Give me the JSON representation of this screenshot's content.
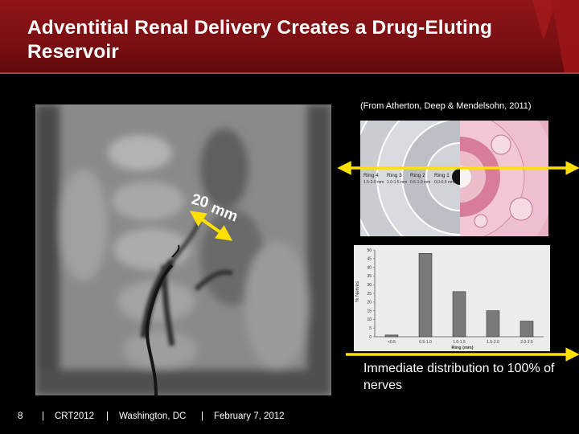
{
  "slide": {
    "title": "Adventitial Renal Delivery Creates a Drug-Eluting Reservoir",
    "citation": "(From Atherton, Deep & Mendelsohn, 2011)",
    "measurement": {
      "number": "20",
      "unit": "mm"
    },
    "caption": "Immediate distribution to 100% of nerves"
  },
  "diagram": {
    "rings": [
      {
        "name": "Ring 4",
        "range": "1.5-2.0 mm"
      },
      {
        "name": "Ring 3",
        "range": "1.0-1.5 mm"
      },
      {
        "name": "Ring 2",
        "range": "0.5-1.0 mm"
      },
      {
        "name": "Ring 1",
        "range": "0.0-0.5 mm"
      }
    ]
  },
  "chart_data": {
    "type": "bar",
    "categories": [
      "<0.5",
      "0.5-1.0",
      "1.0-1.5",
      "1.5-2.0",
      "2.0-2.5"
    ],
    "values": [
      1,
      48,
      26,
      15,
      9
    ],
    "ylim": [
      0,
      50
    ],
    "yticks": [
      "0",
      "5",
      "10",
      "15",
      "20",
      "25",
      "30",
      "35",
      "40",
      "45",
      "50"
    ],
    "xlabel": "Ring (mm)",
    "ylabel": "% Nerves",
    "bar_color": "#7a7a7a"
  },
  "footer": {
    "page_number": "8",
    "event": "CRT2012",
    "location": "Washington, DC",
    "date": "February 7, 2012",
    "separator": "|"
  },
  "colors": {
    "header_red": "#7a0f12",
    "arrow_yellow": "#ffe000",
    "background": "#000000"
  }
}
